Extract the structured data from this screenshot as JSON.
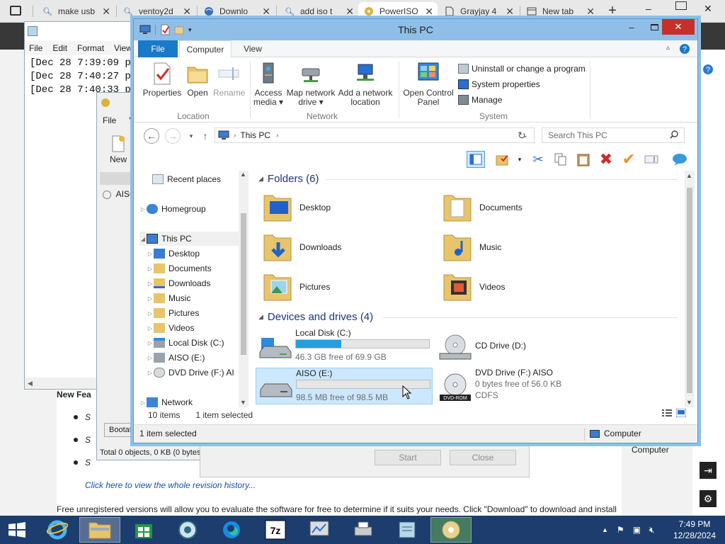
{
  "browser": {
    "tabs": [
      {
        "label": "make usb",
        "icon": "search-icon"
      },
      {
        "label": "ventoy2d",
        "icon": "search-icon"
      },
      {
        "label": "Downlo",
        "icon": "globe-icon"
      },
      {
        "label": "add iso t",
        "icon": "search-icon"
      },
      {
        "label": "PowerISO",
        "icon": "disc-icon"
      },
      {
        "label": "Grayjay 4",
        "icon": "document-icon"
      },
      {
        "label": "New tab",
        "icon": "newtab-icon"
      }
    ],
    "page": {
      "heading_fragment": "New Fea",
      "bullet_fragment": "S",
      "link": "Click here to view the whole revision history...",
      "footer_text": "Free unregistered versions will allow you to evaluate the software for free to determine if it suits your needs. Click \"Download\" to download and install"
    }
  },
  "notepad": {
    "menu": [
      "File",
      "Edit",
      "Format",
      "View"
    ],
    "lines": [
      "[Dec 28 7:39:09 pm",
      "[Dec 28 7:40:27 pm",
      "[Dec 28 7:40:33 pm"
    ]
  },
  "aiso_window": {
    "menu": [
      "File",
      "V"
    ],
    "new_label": "New",
    "tree_item": "AISO",
    "tab_label": "Bootat",
    "status": "Total 0 objects, 0 KB (0 bytes"
  },
  "dialog": {
    "start_label": "Start",
    "close_label": "Close",
    "computer_label": "Computer"
  },
  "explorer": {
    "title": "This PC",
    "ribbon_tabs": [
      "File",
      "Computer",
      "View"
    ],
    "ribbon": {
      "properties": "Properties",
      "open": "Open",
      "rename": "Rename",
      "access_media": "Access media ▾",
      "map_network_drive": "Map network drive ▾",
      "add_network_location": "Add a network location",
      "open_control_panel": "Open Control Panel",
      "uninstall": "Uninstall or change a program",
      "system_properties": "System properties",
      "manage": "Manage",
      "group_location": "Location",
      "group_network": "Network",
      "group_system": "System"
    },
    "address": {
      "path": "This PC",
      "search_placeholder": "Search This PC"
    },
    "nav": {
      "recent_places": "Recent places",
      "homegroup": "Homegroup",
      "this_pc": "This PC",
      "children": [
        "Desktop",
        "Documents",
        "Downloads",
        "Music",
        "Pictures",
        "Videos",
        "Local Disk (C:)",
        "AISO (E:)",
        "DVD Drive (F:) AI"
      ],
      "network": "Network"
    },
    "folders_header": "Folders (6)",
    "folders": [
      "Desktop",
      "Documents",
      "Downloads",
      "Music",
      "Pictures",
      "Videos"
    ],
    "drives_header": "Devices and drives (4)",
    "drives": [
      {
        "name": "Local Disk (C:)",
        "free": "46.3 GB free of 69.9 GB",
        "used_fraction": 0.34
      },
      {
        "name": "CD Drive (D:)"
      },
      {
        "name": "AISO (E:)",
        "free": "98.5 MB free of 98.5 MB",
        "used_fraction": 0.0
      },
      {
        "name": "DVD Drive (F:) AISO",
        "free": "0 bytes free of 56.0 KB",
        "fs": "CDFS"
      }
    ],
    "items_count": "10 items",
    "items_selected": "1 item selected",
    "status_left": "1 item selected",
    "status_right": "Computer"
  },
  "taskbar": {
    "clock_time": "7:49 PM",
    "clock_date": "12/28/2024"
  }
}
